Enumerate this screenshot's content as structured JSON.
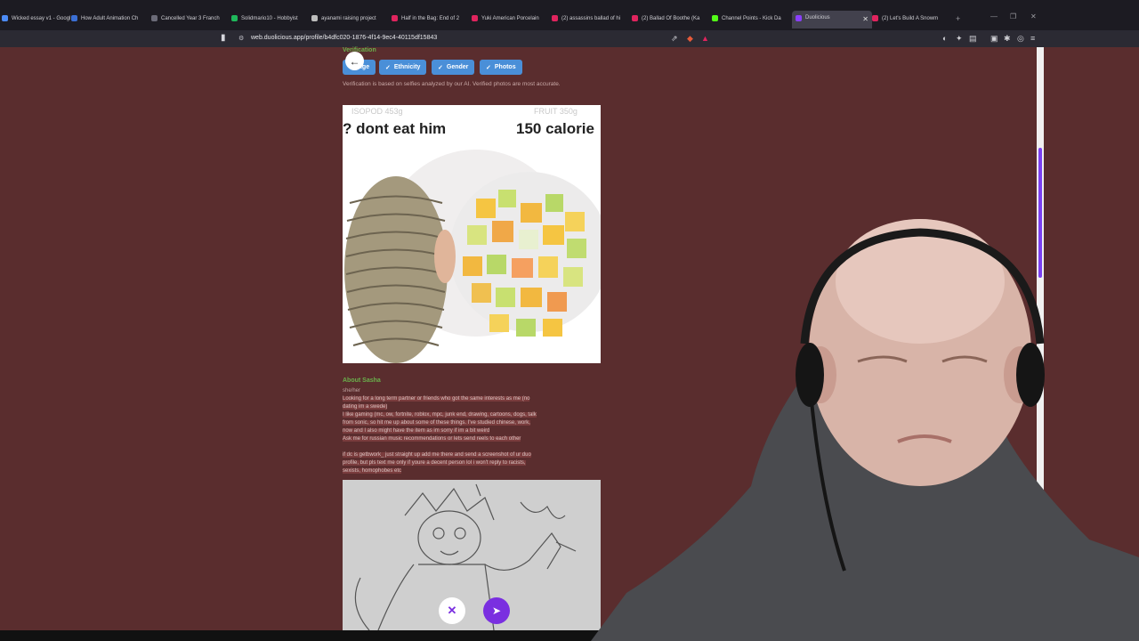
{
  "browser": {
    "tabs": [
      {
        "title": "Wicked essay v1 - Googl",
        "color": "#4c8bf5"
      },
      {
        "title": "How Adult Animation Ch",
        "color": "#3b6fd4"
      },
      {
        "title": "Cancelled Year 3 Franch",
        "color": "#6b6b78"
      },
      {
        "title": "Solidmario10 - Hobbyist",
        "color": "#1fb85b"
      },
      {
        "title": "ayanami raising project",
        "color": "#bdbdbd"
      },
      {
        "title": "Half in the Bag: End of 2",
        "color": "#e0245e"
      },
      {
        "title": "Yuki American Porcelain",
        "color": "#e0245e"
      },
      {
        "title": "(2) assassins ballad of hi",
        "color": "#e0245e"
      },
      {
        "title": "(2) Ballad Of Boothe (Ka",
        "color": "#e0245e"
      },
      {
        "title": "Channel Points - Kick Da",
        "color": "#53fc18"
      },
      {
        "title": "Duolicious",
        "color": "#8a3ffc",
        "active": true
      },
      {
        "title": "(2) Let's Build A Snowm",
        "color": "#e0245e"
      }
    ],
    "new_tab": "+",
    "url": "web.duolicious.app/profile/b4dfc020-1876-4f14-9ec4-40115df15843"
  },
  "profile": {
    "verification_title": "Verification",
    "back_icon": "arrow-left-icon",
    "chips": [
      "Age",
      "Ethnicity",
      "Gender",
      "Photos"
    ],
    "verification_note": "Verification is based on selfies analyzed by our AI. Verified photos are most accurate.",
    "photo": {
      "left_caption": "ISOPOD 453g",
      "right_caption": "FRUIT 350g",
      "left_text": "? dont eat him",
      "right_text": "150 calorie"
    },
    "about_title": "About Sasha",
    "pronouns": "she/her",
    "bio_lines": [
      "Looking for a long term partner or friends who got the same interests as me (no",
      "dating im a swede)",
      "I like gaming (mc, ow, fortnite, roblox, mpc, junk end, drawing, cartoons, dogs, talk",
      "from sonic, so hit me up about some of these things. I've studied chinese, work,",
      "now and I also might have the item as im sorry if im a bit weird",
      "Ask me for russian music recommendations or lets send reels to each other",
      "",
      "if dc is getbwork_ just straight up add me there and send a screenshot of ur duo",
      "profile, but pls text me only if youre a decent person lol i won't reply to racists,",
      "sexists, homophobes etc"
    ],
    "actions": {
      "dislike": "✕",
      "send": "➤"
    }
  },
  "colors": {
    "page_bg": "#5a2d2e",
    "chip_bg": "#4a8fd8",
    "accent": "#7a2fe0",
    "section_title": "#6ab04c"
  }
}
